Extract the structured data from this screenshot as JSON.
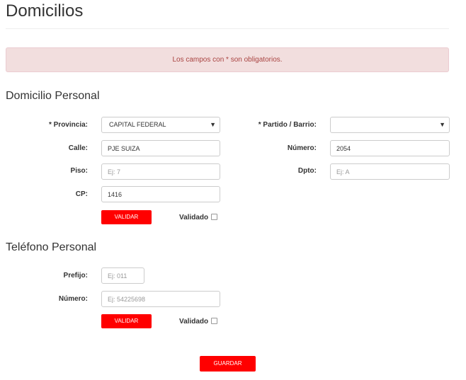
{
  "page": {
    "title": "Domicilios"
  },
  "alert": {
    "text": "Los campos con * son obligatorios."
  },
  "domicilio": {
    "section_title": "Domicilio Personal",
    "provincia_label": "* Provincia:",
    "provincia_value": "CAPITAL FEDERAL",
    "partido_label": "* Partido / Barrio:",
    "partido_value": "",
    "calle_label": "Calle:",
    "calle_value": "PJE SUIZA",
    "numero_label": "Número:",
    "numero_value": "2054",
    "piso_label": "Piso:",
    "piso_placeholder": "Ej: 7",
    "dpto_label": "Dpto:",
    "dpto_placeholder": "Ej: A",
    "cp_label": "CP:",
    "cp_value": "1416",
    "validar_label": "VALIDAR",
    "validado_label": "Validado"
  },
  "telefono": {
    "section_title": "Teléfono Personal",
    "prefijo_label": "Prefijo:",
    "prefijo_placeholder": "Ej: 011",
    "numero_label": "Número:",
    "numero_placeholder": "Ej: 54225698",
    "validar_label": "VALIDAR",
    "validado_label": "Validado"
  },
  "footer": {
    "guardar_label": "GUARDAR"
  },
  "icons": {
    "dropdown_arrow": "chevron-down-icon",
    "checkbox": "checkbox-icon"
  },
  "colors": {
    "primary_button": "#ff0000",
    "alert_background": "#f2dede",
    "alert_text": "#a94442"
  }
}
